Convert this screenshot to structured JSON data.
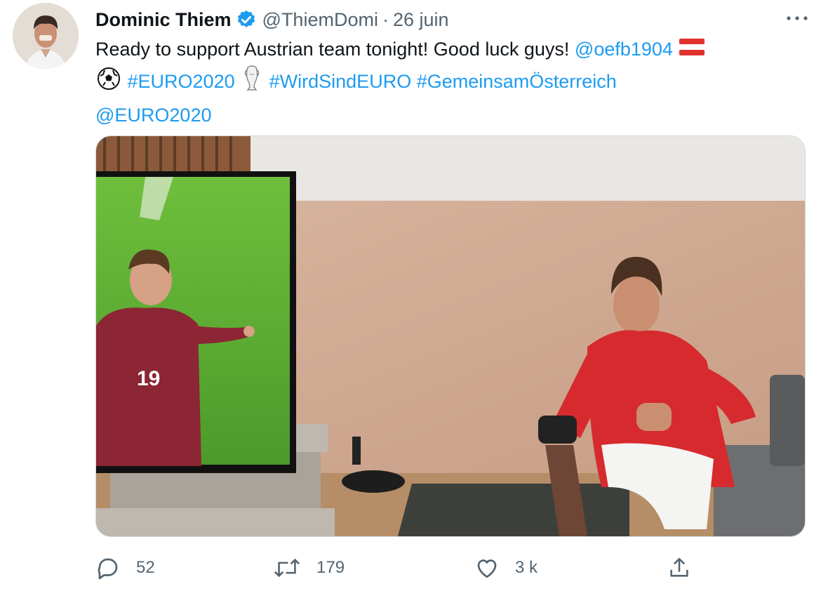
{
  "tweet": {
    "author_name": "Dominic Thiem",
    "handle": "@ThiemDomi",
    "separator": "·",
    "date": "26 juin",
    "text_line1": "Ready to support Austrian team tonight! Good luck guys!",
    "mention_oefb": "@oefb1904",
    "hashtag_euro": "#EURO2020",
    "hashtag_wirsind": "#WirdSindEURO",
    "hashtag_gemeinsam": "#GemeinsamÖsterreich",
    "mention_euro": "@EURO2020",
    "jersey_number": "19",
    "colors": {
      "link": "#1d9bf0",
      "muted": "#536471",
      "text": "#0f1419",
      "verified": "#1d9bf0"
    }
  },
  "actions": {
    "reply_count": "52",
    "retweet_count": "179",
    "like_count": "3 k"
  },
  "icons": {
    "reply": "speech-bubble-icon",
    "retweet": "retweet-arrows-icon",
    "like": "heart-outline-icon",
    "share": "share-upload-icon",
    "more": "ellipsis-icon",
    "verified": "verified-badge-icon"
  }
}
